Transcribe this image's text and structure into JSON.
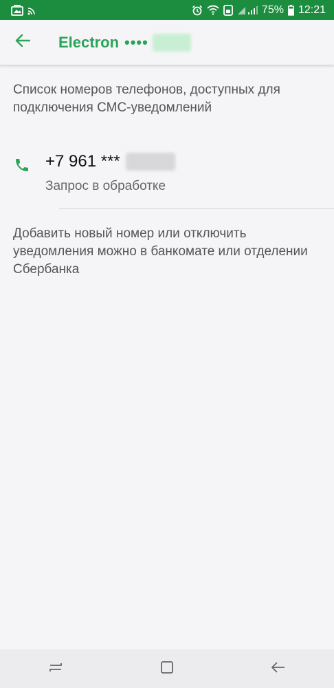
{
  "status_bar": {
    "battery_percent": "75%",
    "time": "12:21",
    "icons": [
      "gallery-icon",
      "cast-icon",
      "alarm-icon",
      "wifi-icon",
      "data-saver-icon",
      "signal-icon",
      "battery-icon"
    ]
  },
  "app_bar": {
    "title": "Electron",
    "masked_number": "••••"
  },
  "intro": {
    "text": "Список номеров телефонов, доступных для подключения СМС-уведомлений"
  },
  "phones": [
    {
      "number": "+7 961 ***",
      "status": "Запрос в обработке"
    }
  ],
  "note": {
    "text": "Добавить новый номер или отключить уведомления можно в банкомате или отделении Сбербанка"
  },
  "colors": {
    "status_bar": "#1c8c3f",
    "accent": "#2aa557",
    "background": "#f5f5f7"
  }
}
